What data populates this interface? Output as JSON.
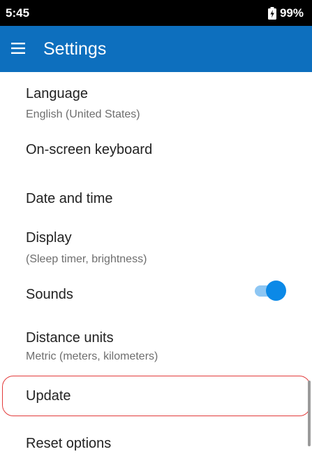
{
  "status_bar": {
    "time": "5:45",
    "battery_percent": "99%",
    "battery_icon": "battery-charging-icon"
  },
  "app_bar": {
    "menu_icon": "hamburger-menu-icon",
    "title": "Settings",
    "color": "#0D6FBE"
  },
  "settings": {
    "language": {
      "label": "Language",
      "value": "English (United States)"
    },
    "keyboard": {
      "label": "On-screen keyboard"
    },
    "date_time": {
      "label": "Date and time"
    },
    "display": {
      "label": "Display",
      "value": "(Sleep timer, brightness)"
    },
    "sounds": {
      "label": "Sounds",
      "enabled": true
    },
    "distance_units": {
      "label": "Distance units",
      "value": "Metric (meters, kilometers)"
    },
    "update": {
      "label": "Update",
      "highlighted": true,
      "highlight_color": "#e23b3b"
    },
    "reset": {
      "label": "Reset options"
    }
  }
}
